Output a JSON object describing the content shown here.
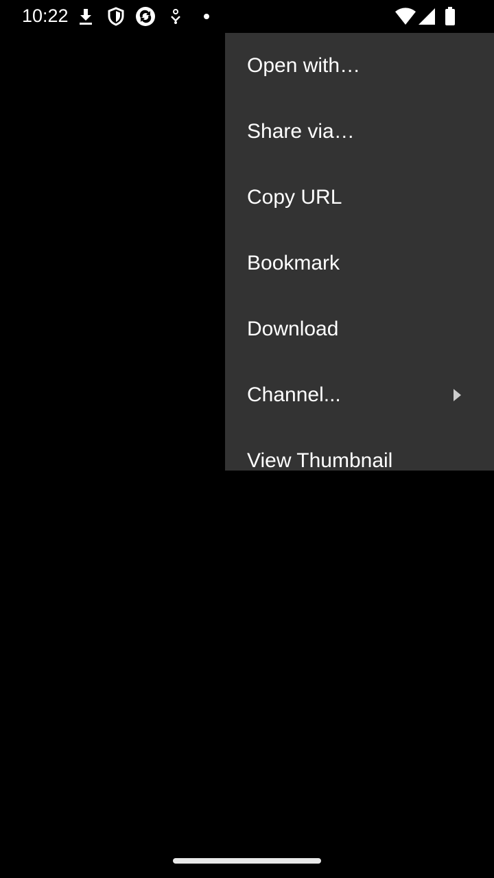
{
  "status_bar": {
    "time": "10:22",
    "left_icons": [
      "download-icon",
      "shield-icon",
      "sync-app-icon",
      "location-pin-icon",
      "notification-dot-icon"
    ],
    "right_icons": [
      "wifi-icon",
      "signal-icon",
      "battery-icon"
    ]
  },
  "menu": {
    "items": [
      {
        "label": "Open with…",
        "has_submenu": false
      },
      {
        "label": "Share via…",
        "has_submenu": false
      },
      {
        "label": "Copy URL",
        "has_submenu": false
      },
      {
        "label": "Bookmark",
        "has_submenu": false
      },
      {
        "label": "Download",
        "has_submenu": false
      },
      {
        "label": "Channel...",
        "has_submenu": true
      },
      {
        "label": "View Thumbnail",
        "has_submenu": false
      }
    ]
  },
  "colors": {
    "background": "#000000",
    "menu_background": "#333333",
    "menu_text": "#ffffff",
    "status_text": "#ffffff"
  }
}
